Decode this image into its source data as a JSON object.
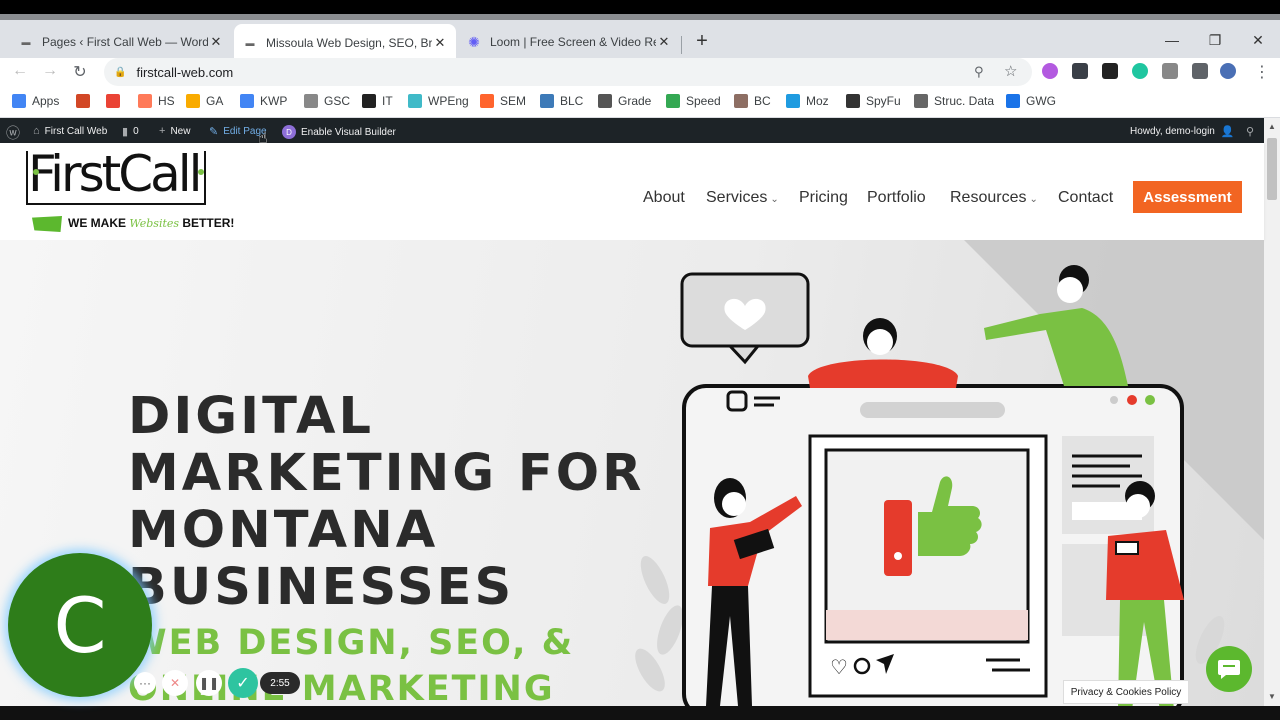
{
  "browser": {
    "tabs": [
      {
        "title": "Pages ‹ First Call Web — WordPress",
        "active": false
      },
      {
        "title": "Missoula Web Design, SEO, Branding",
        "active": true
      },
      {
        "title": "Loom | Free Screen & Video Recording",
        "active": false
      }
    ],
    "new_tab": "+",
    "url": "firstcall-web.com",
    "window_controls": [
      "—",
      "❐",
      "✕"
    ]
  },
  "bookmarks": [
    {
      "label": "Apps",
      "icon": "apps-grid-icon",
      "color": "#4285f4"
    },
    {
      "label": "",
      "icon": "powerpoint-icon",
      "color": "#d24726"
    },
    {
      "label": "",
      "icon": "gmail-icon",
      "color": "#ea4335"
    },
    {
      "label": "HS",
      "icon": "hubspot-icon",
      "color": "#ff7a59"
    },
    {
      "label": "GA",
      "icon": "analytics-icon",
      "color": "#f9ab00"
    },
    {
      "label": "KWP",
      "icon": "google-ads-icon",
      "color": "#4285f4"
    },
    {
      "label": "GSC",
      "icon": "search-console-icon",
      "color": "#888888"
    },
    {
      "label": "IT",
      "icon": "notion-icon",
      "color": "#222222"
    },
    {
      "label": "WPEng",
      "icon": "wpengine-icon",
      "color": "#40bac8"
    },
    {
      "label": "SEM",
      "icon": "semrush-icon",
      "color": "#ff642d"
    },
    {
      "label": "BLC",
      "icon": "blc-icon",
      "color": "#3d7ab8"
    },
    {
      "label": "Grade",
      "icon": "grade-icon",
      "color": "#555555"
    },
    {
      "label": "Speed",
      "icon": "speed-icon",
      "color": "#34a853"
    },
    {
      "label": "BC",
      "icon": "bc-icon",
      "color": "#8d6e63"
    },
    {
      "label": "Moz",
      "icon": "moz-icon",
      "color": "#1f9be0"
    },
    {
      "label": "SpyFu",
      "icon": "spyfu-icon",
      "color": "#333333"
    },
    {
      "label": "Struc. Data",
      "icon": "structured-data-icon",
      "color": "#666666"
    },
    {
      "label": "GWG",
      "icon": "gwg-icon",
      "color": "#1a73e8"
    }
  ],
  "wp_admin": {
    "site": "First Call Web",
    "comments": "0",
    "new": "New",
    "edit": "Edit Page",
    "visual_builder": "Enable Visual Builder",
    "howdy": "Howdy, demo-login"
  },
  "site": {
    "logo": {
      "name": "FirstCall",
      "tag_before": "WE MAKE",
      "tag_script": "Websites",
      "tag_after": "BETTER!"
    },
    "nav": [
      {
        "label": "About",
        "dropdown": false
      },
      {
        "label": "Services",
        "dropdown": true
      },
      {
        "label": "Pricing",
        "dropdown": false
      },
      {
        "label": "Portfolio",
        "dropdown": false
      },
      {
        "label": "Resources",
        "dropdown": true
      },
      {
        "label": "Contact",
        "dropdown": false
      }
    ],
    "cta": "Assessment",
    "hero": {
      "heading": [
        "DIGITAL",
        "MARKETING FOR",
        "MONTANA",
        "BUSINESSES"
      ],
      "subheading": [
        "WEB DESIGN, SEO, &",
        "ONLINE MARKETING"
      ]
    }
  },
  "loom": {
    "avatar_letter": "C",
    "timer": "2:55"
  },
  "privacy_label": "Privacy & Cookies Policy",
  "colors": {
    "accent_orange": "#f26522",
    "brand_green": "#7ac143",
    "wp_bar": "#1d2327",
    "avatar_green": "#2e7d1a"
  }
}
